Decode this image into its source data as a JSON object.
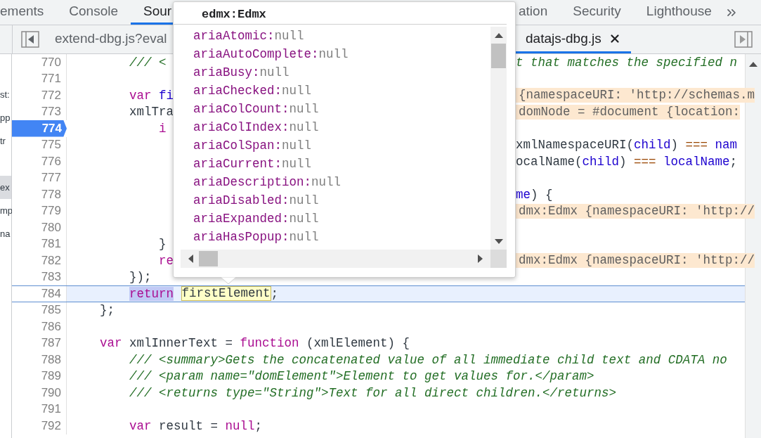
{
  "top_tabs": {
    "left": [
      {
        "label": "ements",
        "selected": false
      },
      {
        "label": "Console",
        "selected": false
      },
      {
        "label": "Sour",
        "selected": true
      }
    ],
    "right": [
      {
        "label": "ation",
        "selected": false
      },
      {
        "label": "Security",
        "selected": false
      },
      {
        "label": "Lighthouse",
        "selected": false
      }
    ]
  },
  "file_tabs": {
    "left": [
      {
        "label": "extend-dbg.js?eval",
        "selected": false
      }
    ],
    "right": [
      {
        "label": "datajs-dbg.js",
        "selected": true,
        "closable": true
      }
    ]
  },
  "navigator": [
    {
      "label": "st:",
      "selected": false
    },
    {
      "label": "pp",
      "selected": false
    },
    {
      "label": "tr",
      "selected": false
    },
    {
      "label": "ex",
      "selected": true
    },
    {
      "label": "mp",
      "selected": false
    },
    {
      "label": "na",
      "selected": false
    }
  ],
  "lines": [
    {
      "number": "770",
      "breakpoint": false,
      "highlighted": false,
      "left": [
        {
          "kind": "comment",
          "text": "        /// <"
        }
      ],
      "right": [
        {
          "kind": "comment",
          "text": "t that matches the specified n"
        }
      ]
    },
    {
      "number": "771",
      "breakpoint": false,
      "highlighted": false
    },
    {
      "number": "772",
      "breakpoint": false,
      "highlighted": false,
      "left": [
        {
          "kind": "keyword",
          "text": "        var "
        },
        {
          "kind": "name",
          "text": "fi"
        }
      ],
      "right": [
        {
          "kind": "value",
          "text": "{namespaceURI: 'http://schemas.m"
        }
      ]
    },
    {
      "number": "773",
      "breakpoint": false,
      "highlighted": false,
      "left": [
        {
          "kind": "plain",
          "text": "        xmlTra"
        }
      ],
      "right": [
        {
          "kind": "value",
          "text": "domNode = #document {location:"
        }
      ]
    },
    {
      "number": "774",
      "breakpoint": true,
      "highlighted": false,
      "left": [
        {
          "kind": "keyword",
          "text": "            i"
        }
      ]
    },
    {
      "number": "775",
      "breakpoint": false,
      "highlighted": false,
      "right": [
        {
          "kind": "plain",
          "text": "xmlNamespaceURI("
        },
        {
          "kind": "name",
          "text": "child"
        },
        {
          "kind": "plain",
          "text": ") "
        },
        {
          "kind": "operator",
          "text": "=== "
        },
        {
          "kind": "name",
          "text": "nam"
        }
      ]
    },
    {
      "number": "776",
      "breakpoint": false,
      "highlighted": false,
      "right": [
        {
          "kind": "plain",
          "text": "ocalName("
        },
        {
          "kind": "name",
          "text": "child"
        },
        {
          "kind": "plain",
          "text": ") "
        },
        {
          "kind": "operator",
          "text": "=== "
        },
        {
          "kind": "name",
          "text": "localName"
        },
        {
          "kind": "plain",
          "text": ";"
        }
      ]
    },
    {
      "number": "777",
      "breakpoint": false,
      "highlighted": false
    },
    {
      "number": "778",
      "breakpoint": false,
      "highlighted": false,
      "right": [
        {
          "kind": "name",
          "text": "me"
        },
        {
          "kind": "plain",
          "text": ") {"
        }
      ]
    },
    {
      "number": "779",
      "breakpoint": false,
      "highlighted": false,
      "right": [
        {
          "kind": "value",
          "text": "dmx:Edmx {namespaceURI: 'http://"
        }
      ]
    },
    {
      "number": "780",
      "breakpoint": false,
      "highlighted": false
    },
    {
      "number": "781",
      "breakpoint": false,
      "highlighted": false,
      "left": [
        {
          "kind": "plain",
          "text": "            }"
        }
      ]
    },
    {
      "number": "782",
      "breakpoint": false,
      "highlighted": false,
      "left": [
        {
          "kind": "keyword",
          "text": "            re"
        }
      ],
      "right": [
        {
          "kind": "value",
          "text": "dmx:Edmx {namespaceURI: 'http://"
        }
      ]
    },
    {
      "number": "783",
      "breakpoint": false,
      "highlighted": false,
      "left": [
        {
          "kind": "plain",
          "text": "        });"
        }
      ]
    },
    {
      "number": "784",
      "breakpoint": false,
      "highlighted": true,
      "full": [
        {
          "kind": "selection",
          "text": "return"
        },
        {
          "kind": "evaluated",
          "text": "firstElement"
        },
        {
          "kind": "plain",
          "text": ";"
        }
      ]
    },
    {
      "number": "785",
      "breakpoint": false,
      "highlighted": false,
      "full": [
        {
          "kind": "plain",
          "text": "    };"
        }
      ]
    },
    {
      "number": "786",
      "breakpoint": false,
      "highlighted": false
    },
    {
      "number": "787",
      "breakpoint": false,
      "highlighted": false,
      "full": [
        {
          "kind": "keyword",
          "text": "    var"
        },
        {
          "kind": "plain",
          "text": " xmlInnerText = "
        },
        {
          "kind": "keyword",
          "text": "function"
        },
        {
          "kind": "plain",
          "text": " (xmlElement) {"
        }
      ]
    },
    {
      "number": "788",
      "breakpoint": false,
      "highlighted": false,
      "full": [
        {
          "kind": "comment",
          "text": "        /// <summary>Gets the concatenated value of all immediate child text and CDATA no"
        }
      ]
    },
    {
      "number": "789",
      "breakpoint": false,
      "highlighted": false,
      "full": [
        {
          "kind": "comment",
          "text": "        /// <param name=\"domElement\">Element to get values for.</param>"
        }
      ]
    },
    {
      "number": "790",
      "breakpoint": false,
      "highlighted": false,
      "full": [
        {
          "kind": "comment",
          "text": "        /// <returns type=\"String\">Text for all direct children.</returns>"
        }
      ]
    },
    {
      "number": "791",
      "breakpoint": false,
      "highlighted": false
    },
    {
      "number": "792",
      "breakpoint": false,
      "highlighted": false,
      "full": [
        {
          "kind": "keyword",
          "text": "        var"
        },
        {
          "kind": "plain",
          "text": " result = "
        },
        {
          "kind": "keyword",
          "text": "null"
        },
        {
          "kind": "plain",
          "text": ";"
        }
      ]
    }
  ],
  "popover": {
    "title": "edmx:Edmx",
    "properties": [
      {
        "name": "ariaAtomic:",
        "value": "null"
      },
      {
        "name": "ariaAutoComplete:",
        "value": "null"
      },
      {
        "name": "ariaBusy:",
        "value": "null"
      },
      {
        "name": "ariaChecked:",
        "value": "null"
      },
      {
        "name": "ariaColCount:",
        "value": "null"
      },
      {
        "name": "ariaColIndex:",
        "value": "null"
      },
      {
        "name": "ariaColSpan:",
        "value": "null"
      },
      {
        "name": "ariaCurrent:",
        "value": "null"
      },
      {
        "name": "ariaDescription:",
        "value": "null"
      },
      {
        "name": "ariaDisabled:",
        "value": "null"
      },
      {
        "name": "ariaExpanded:",
        "value": "null"
      },
      {
        "name": "ariaHasPopup:",
        "value": "null"
      }
    ]
  }
}
